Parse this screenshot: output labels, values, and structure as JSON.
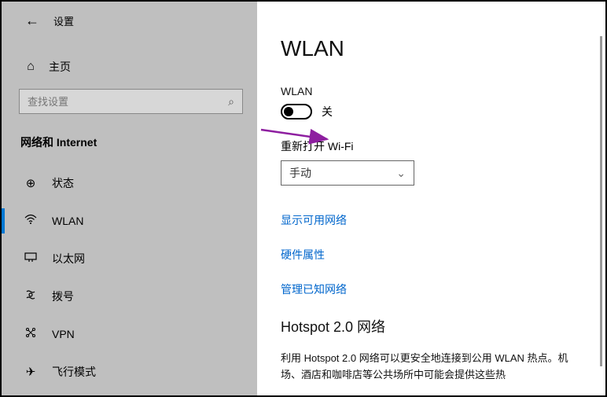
{
  "titlebar": {
    "title": "设置"
  },
  "home": {
    "label": "主页"
  },
  "search": {
    "placeholder": "查找设置"
  },
  "section": {
    "title": "网络和 Internet"
  },
  "nav": {
    "items": [
      {
        "label": "状态"
      },
      {
        "label": "WLAN"
      },
      {
        "label": "以太网"
      },
      {
        "label": "拨号"
      },
      {
        "label": "VPN"
      },
      {
        "label": "飞行模式"
      }
    ]
  },
  "page": {
    "heading": "WLAN",
    "wlan_label": "WLAN",
    "toggle_state": "关",
    "reconnect_label": "重新打开 Wi-Fi",
    "dropdown_value": "手动",
    "links": {
      "show_networks": "显示可用网络",
      "hw_props": "硬件属性",
      "manage_known": "管理已知网络"
    },
    "hotspot_heading": "Hotspot 2.0 网络",
    "hotspot_body": "利用 Hotspot 2.0 网络可以更安全地连接到公用 WLAN 热点。机场、酒店和咖啡店等公共场所中可能会提供这些热"
  },
  "colors": {
    "accent": "#0078d4",
    "link": "#0066cc"
  }
}
